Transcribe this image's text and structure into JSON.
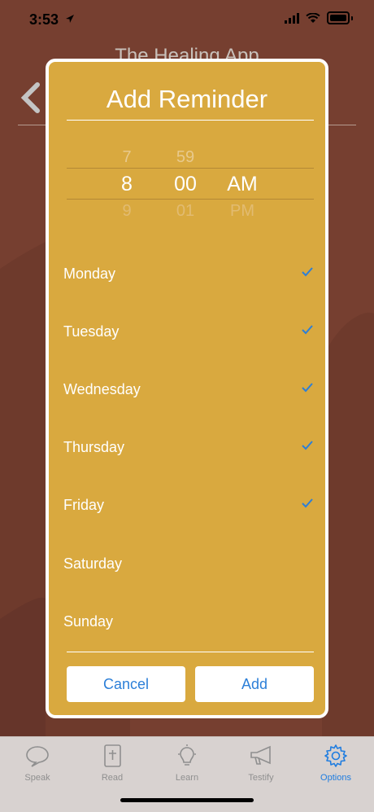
{
  "status_bar": {
    "time": "3:53"
  },
  "app": {
    "title": "The Healing App"
  },
  "modal": {
    "title": "Add Reminder",
    "picker": {
      "hour": {
        "prev": "7",
        "selected": "8",
        "next": "9"
      },
      "minute": {
        "prev": "59",
        "selected": "00",
        "next": "01"
      },
      "period": {
        "selected": "AM",
        "next": "PM"
      }
    },
    "days": [
      {
        "label": "Monday",
        "checked": true
      },
      {
        "label": "Tuesday",
        "checked": true
      },
      {
        "label": "Wednesday",
        "checked": true
      },
      {
        "label": "Thursday",
        "checked": true
      },
      {
        "label": "Friday",
        "checked": true
      },
      {
        "label": "Saturday",
        "checked": false
      },
      {
        "label": "Sunday",
        "checked": false
      }
    ],
    "cancel_label": "Cancel",
    "add_label": "Add"
  },
  "tabs": [
    {
      "label": "Speak",
      "icon": "speech-bubble-icon",
      "active": false
    },
    {
      "label": "Read",
      "icon": "bible-icon",
      "active": false
    },
    {
      "label": "Learn",
      "icon": "lightbulb-icon",
      "active": false
    },
    {
      "label": "Testify",
      "icon": "megaphone-icon",
      "active": false
    },
    {
      "label": "Options",
      "icon": "gear-icon",
      "active": true
    }
  ],
  "colors": {
    "background": "#763f30",
    "modal": "#d9a93f",
    "accent": "#2c7fd8"
  }
}
